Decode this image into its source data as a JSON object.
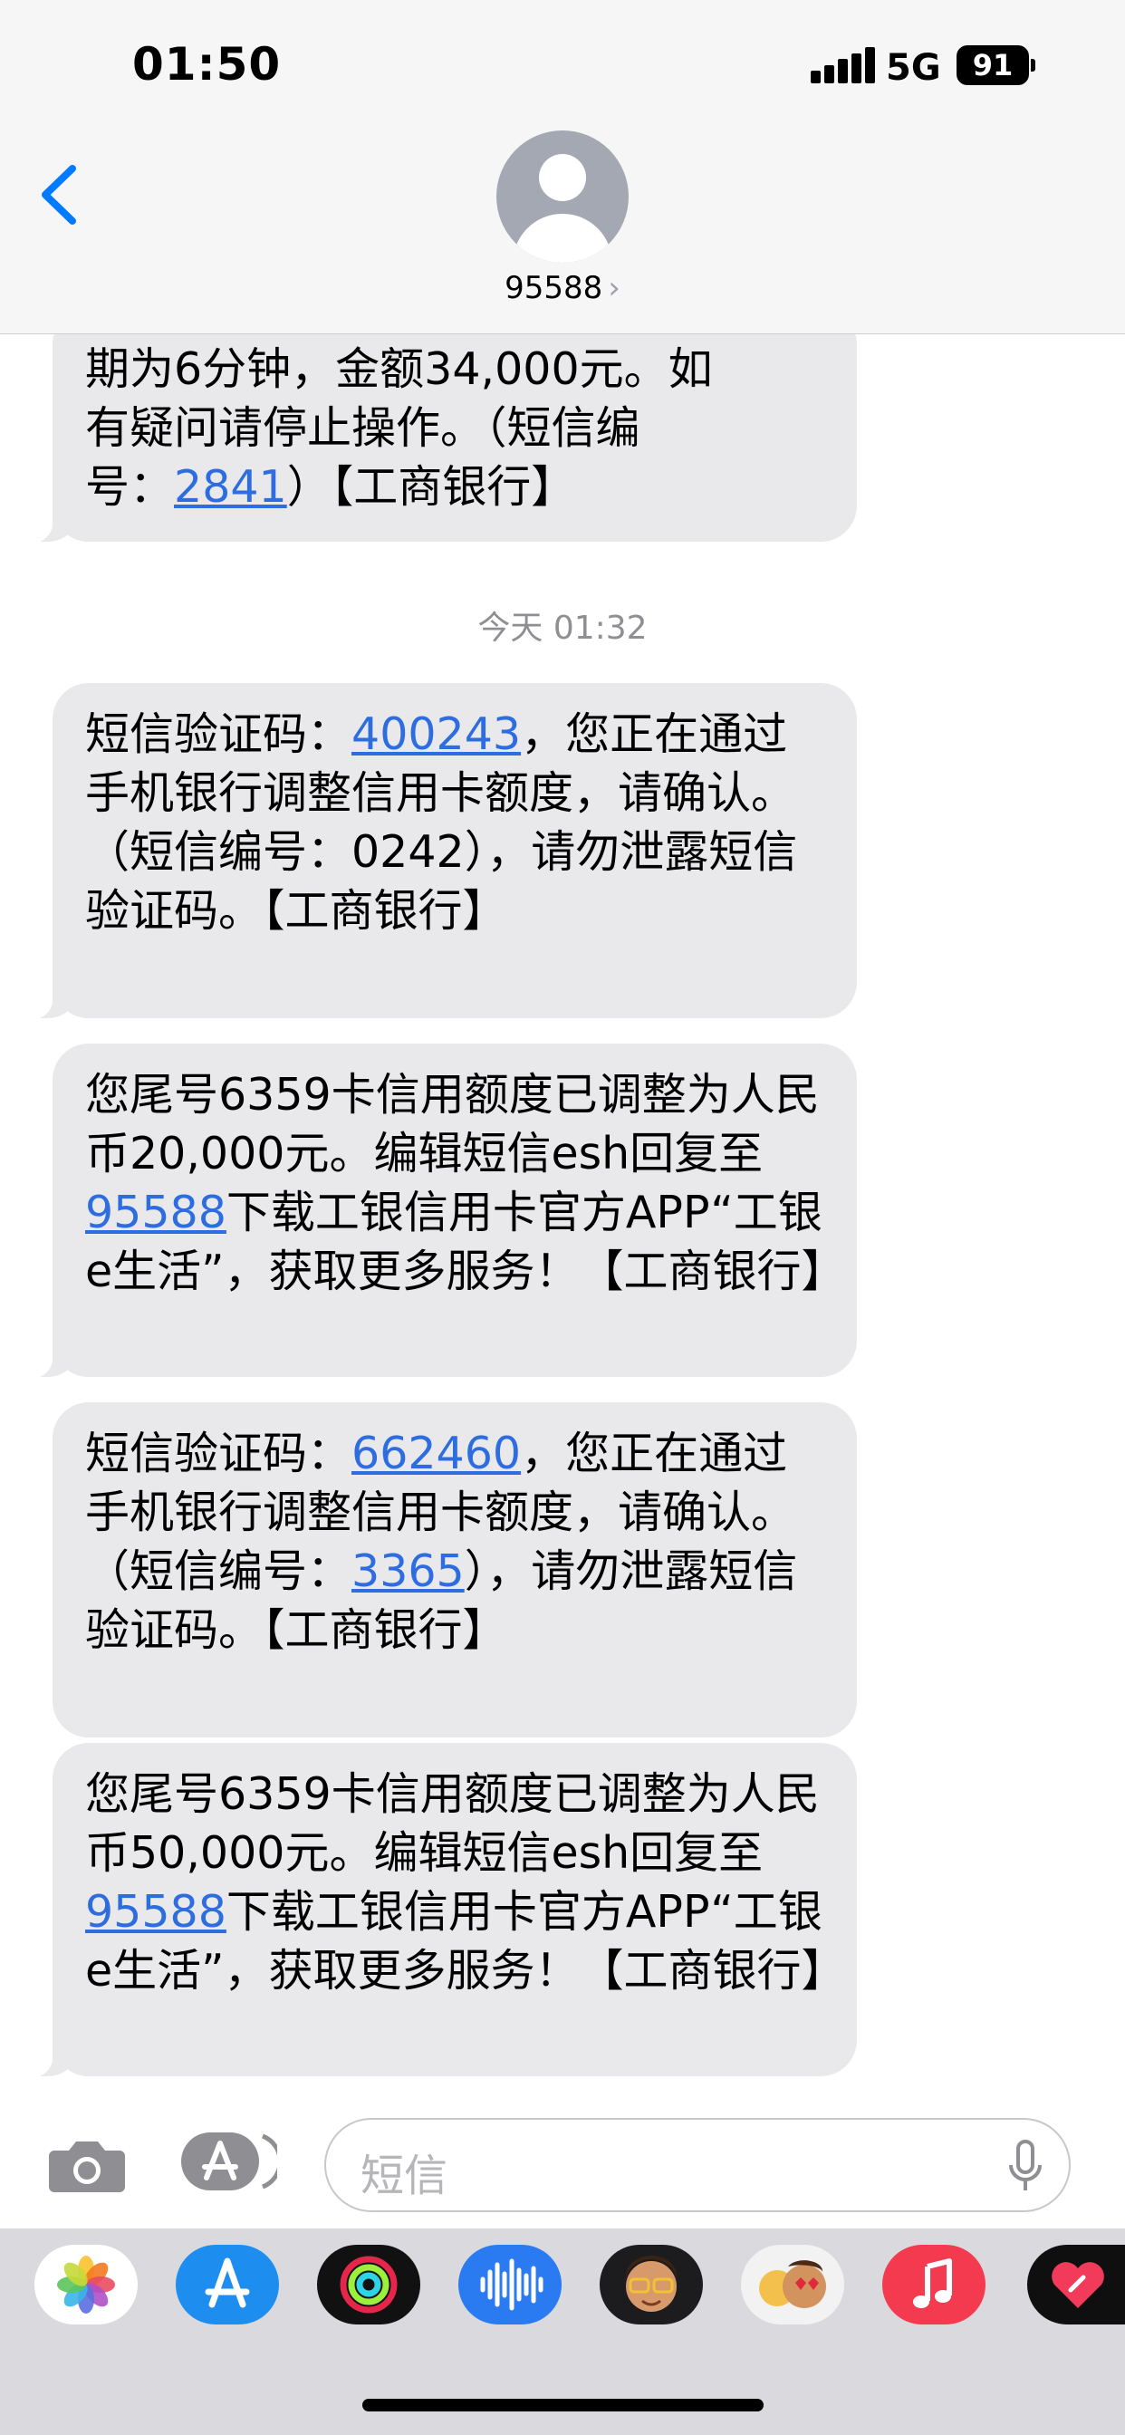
{
  "status_bar": {
    "time": "01:50",
    "network": "5G",
    "battery": "91"
  },
  "header": {
    "contact": "95588",
    "chevron": "›"
  },
  "messages": [
    {
      "pre": "",
      "line1": "期为6分钟，金额34,000元。如",
      "line2": "有疑问请停止操作。（短信编",
      "line3_pre": "号：",
      "line3_link": "2841",
      "line3_post": "）【工商银行】"
    },
    {
      "timestamp": "今天 01:32"
    },
    {
      "pre": "短信验证码：",
      "code": "400243",
      "post": "，您正在通过手机银行调整信用卡额度，请确认。（短信编号：0242），请勿泄露短信验证码。【工商银行】"
    },
    {
      "pre": "您尾号6359卡信用额度已调整为人民币20,000元。编辑短信esh回复至",
      "link": "95588",
      "post": "下载工银信用卡官方APP“工银e生活”，获取更多服务！【工商银行】"
    },
    {
      "pre": "短信验证码：",
      "code": "662460",
      "mid": "，您正在通过手机银行调整信用卡额度，请确认。（短信编号：",
      "link": "3365",
      "post": "），请勿泄露短信验证码。【工商银行】"
    },
    {
      "pre": "您尾号6359卡信用额度已调整为人民币50,000元。编辑短信esh回复至",
      "link": "95588",
      "post": "下载工银信用卡官方APP“工银e生活”，获取更多服务！【工商银行】"
    }
  ],
  "compose": {
    "placeholder": "短信"
  },
  "colors": {
    "link": "#2e6de0",
    "bubble": "#e9e9eb",
    "accent": "#007aff"
  },
  "dock_apps": [
    "photos-icon",
    "app-store-icon",
    "fitness-icon",
    "voice-memos-icon",
    "memoji-sticker-icon",
    "memoji-hearts-icon",
    "music-icon",
    "digital-touch-icon"
  ]
}
